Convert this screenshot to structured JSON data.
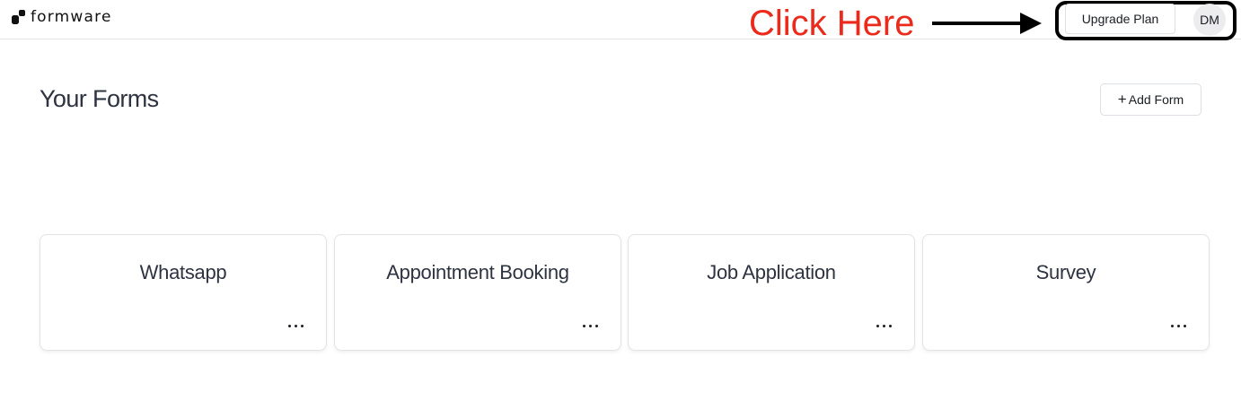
{
  "header": {
    "brand": "formware",
    "upgrade_label": "Upgrade Plan",
    "avatar_initials": "DM"
  },
  "annotation": {
    "text": "Click Here",
    "color": "#ec2a1c"
  },
  "main": {
    "title": "Your Forms",
    "add_form_icon": "plus-icon",
    "add_form_plus": "+",
    "add_form_label": "Add Form"
  },
  "forms": [
    {
      "title": "Whatsapp"
    },
    {
      "title": "Appointment Booking"
    },
    {
      "title": "Job Application"
    },
    {
      "title": "Survey"
    }
  ],
  "icons": {
    "logo": "formware-logo-icon",
    "card_menu": "more-horizontal-icon"
  }
}
